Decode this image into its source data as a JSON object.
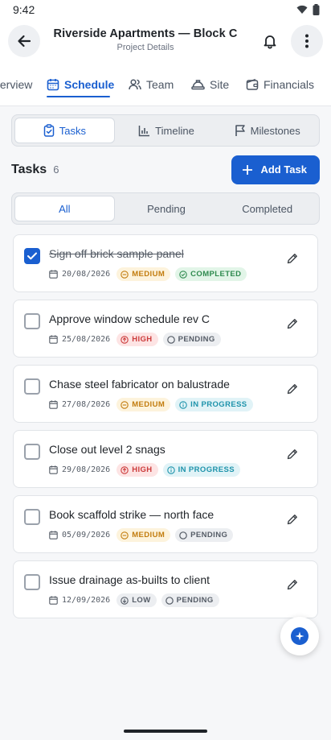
{
  "status_bar": {
    "time": "9:42"
  },
  "header": {
    "title": "Riverside Apartments — Block C",
    "subtitle": "Project Details"
  },
  "nav_tabs": [
    {
      "label": "Overview",
      "icon": "overview-icon"
    },
    {
      "label": "Schedule",
      "icon": "calendar-icon",
      "active": true
    },
    {
      "label": "Team",
      "icon": "people-icon"
    },
    {
      "label": "Site",
      "icon": "hardhat-icon"
    },
    {
      "label": "Financials",
      "icon": "wallet-icon"
    }
  ],
  "view_tabs": [
    {
      "label": "Tasks",
      "icon": "clipboard-icon",
      "active": true
    },
    {
      "label": "Timeline",
      "icon": "bar-chart-icon"
    },
    {
      "label": "Milestones",
      "icon": "flag-icon"
    }
  ],
  "tasks_section": {
    "title": "Tasks",
    "count": "6",
    "add_label": "Add Task"
  },
  "filters": [
    {
      "label": "All",
      "active": true
    },
    {
      "label": "Pending"
    },
    {
      "label": "Completed"
    }
  ],
  "tasks": [
    {
      "title": "Sign off brick sample panel",
      "date": "20/08/2026",
      "priority": "MEDIUM",
      "status": "COMPLETED",
      "checked": true
    },
    {
      "title": "Approve window schedule rev C",
      "date": "25/08/2026",
      "priority": "HIGH",
      "status": "PENDING",
      "checked": false
    },
    {
      "title": "Chase steel fabricator on balustrade",
      "date": "27/08/2026",
      "priority": "MEDIUM",
      "status": "IN PROGRESS",
      "checked": false
    },
    {
      "title": "Close out level 2 snags",
      "date": "29/08/2026",
      "priority": "HIGH",
      "status": "IN PROGRESS",
      "checked": false
    },
    {
      "title": "Book scaffold strike — north face",
      "date": "05/09/2026",
      "priority": "MEDIUM",
      "status": "PENDING",
      "checked": false
    },
    {
      "title": "Issue drainage as-builts to client",
      "date": "12/09/2026",
      "priority": "LOW",
      "status": "PENDING",
      "checked": false
    }
  ],
  "colors": {
    "accent": "#1a5fd0",
    "medium": "#c27c0e",
    "high": "#cc3b3b",
    "completed": "#2e8a4e",
    "in_progress": "#1e93ab"
  }
}
